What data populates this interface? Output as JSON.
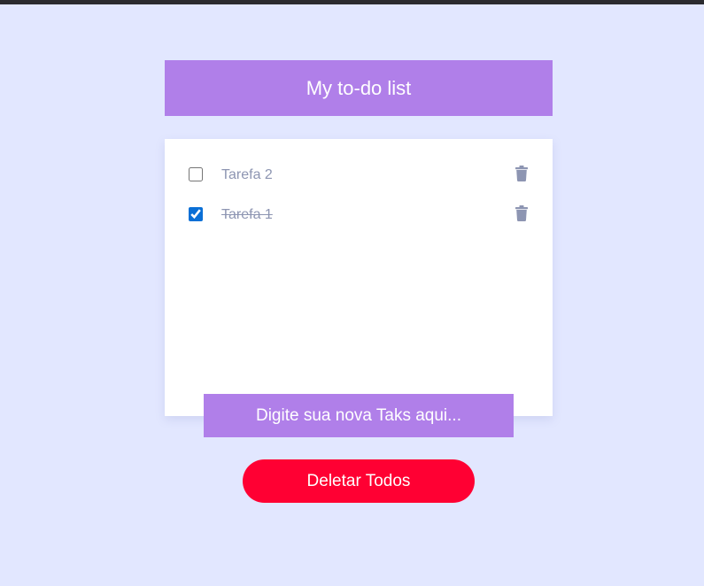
{
  "header": {
    "title": "My to-do list"
  },
  "todos": [
    {
      "text": "Tarefa 2",
      "done": false
    },
    {
      "text": "Tarefa 1",
      "done": true
    }
  ],
  "new_task": {
    "placeholder": "Digite sua nova Taks aqui...",
    "value": ""
  },
  "actions": {
    "delete_all_label": "Deletar Todos"
  },
  "icons": {
    "delete": "trash-icon"
  },
  "colors": {
    "background": "#e2e7ff",
    "accent_purple": "#b07fe9",
    "danger_red": "#ff0033",
    "muted_text": "#8d95b2",
    "icon_gray": "#8d95b2",
    "card": "#ffffff"
  }
}
